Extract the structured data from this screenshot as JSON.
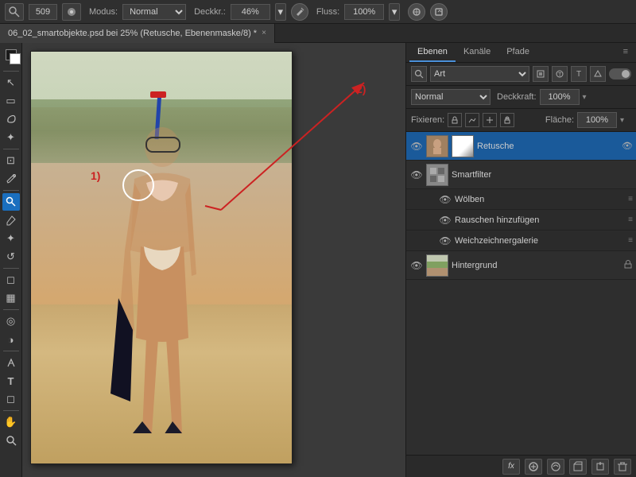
{
  "toolbar": {
    "brush_size": "509",
    "mode_label": "Modus:",
    "mode_value": "Normal",
    "opacity_label": "Deckkr.:",
    "opacity_value": "46%",
    "flow_label": "Fluss:",
    "flow_value": "100%"
  },
  "tab": {
    "title": "06_02_smartobjekte.psd bei 25% (Retusche, Ebenenmaske/8) *",
    "close": "×"
  },
  "annotations": {
    "label1": "1)",
    "label2": "2)"
  },
  "panels": {
    "layers_tab": "Ebenen",
    "channels_tab": "Kanäle",
    "paths_tab": "Pfade",
    "filter_placeholder": "Art",
    "blend_mode": "Normal",
    "opacity_label": "Deckkraft:",
    "opacity_value": "100%",
    "lock_label": "Fixieren:",
    "area_label": "Fläche:",
    "area_value": "100%"
  },
  "layers": [
    {
      "name": "Retusche",
      "visible": true,
      "active": true,
      "has_mask": true,
      "lock": false,
      "type": "layer",
      "children": []
    },
    {
      "name": "Smartfilter",
      "visible": true,
      "active": false,
      "type": "smartfilter",
      "children": [
        {
          "name": "Wölben",
          "visible": true
        },
        {
          "name": "Rauschen hinzufügen",
          "visible": true
        },
        {
          "name": "Weichzeichnergalerie",
          "visible": true
        }
      ]
    },
    {
      "name": "Hintergrund",
      "visible": true,
      "active": false,
      "type": "layer",
      "lock": true
    }
  ],
  "panel_bottom_buttons": [
    "fx",
    "circle",
    "page",
    "trash"
  ],
  "tools": [
    {
      "name": "marquee",
      "icon": "▭"
    },
    {
      "name": "lasso",
      "icon": "⌒"
    },
    {
      "name": "crop",
      "icon": "⊡"
    },
    {
      "name": "eyedropper",
      "icon": "✒"
    },
    {
      "name": "heal",
      "icon": "⊕"
    },
    {
      "name": "brush",
      "icon": "✏"
    },
    {
      "name": "clone",
      "icon": "✦"
    },
    {
      "name": "history",
      "icon": "↺"
    },
    {
      "name": "eraser",
      "icon": "◻"
    },
    {
      "name": "gradient",
      "icon": "▦"
    },
    {
      "name": "blur",
      "icon": "◎"
    },
    {
      "name": "dodge",
      "icon": "◑"
    },
    {
      "name": "pen",
      "icon": "✒"
    },
    {
      "name": "type",
      "icon": "T"
    },
    {
      "name": "shape",
      "icon": "◻"
    },
    {
      "name": "selection",
      "icon": "↖"
    },
    {
      "name": "hand",
      "icon": "✋"
    },
    {
      "name": "zoom",
      "icon": "🔍"
    },
    {
      "name": "color-fg",
      "icon": "■"
    },
    {
      "name": "color-bg",
      "icon": "□"
    }
  ]
}
